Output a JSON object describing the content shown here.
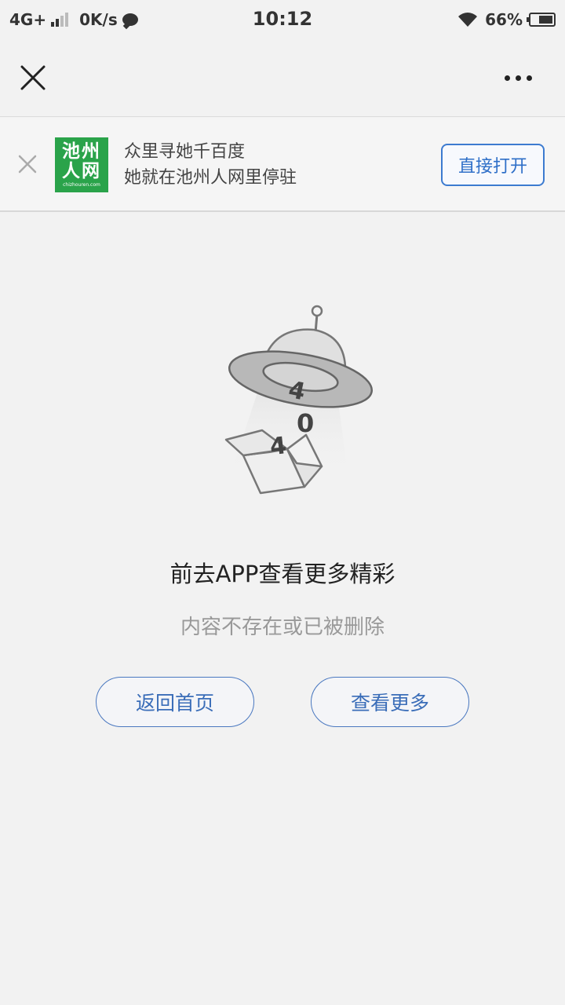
{
  "status_bar": {
    "network": "4G+",
    "speed": "0K/s",
    "time": "10:12",
    "battery": "66%",
    "battery_level": 0.66
  },
  "nav": {
    "close_icon": "close-icon",
    "more_icon": "more-dots-icon"
  },
  "banner": {
    "logo": {
      "line1": "池州",
      "line2": "人网",
      "small": "chizhouren.com"
    },
    "line1": "众里寻她千百度",
    "line2": "她就在池州人网里停驻",
    "open_label": "直接打开",
    "accent": "#2aa34a",
    "button_color": "#3c7bd0"
  },
  "illustration": {
    "digits": [
      "4",
      "0",
      "4"
    ]
  },
  "message": {
    "title": "前去APP查看更多精彩",
    "subtitle": "内容不存在或已被删除"
  },
  "actions": {
    "home_label": "返回首页",
    "more_label": "查看更多"
  }
}
